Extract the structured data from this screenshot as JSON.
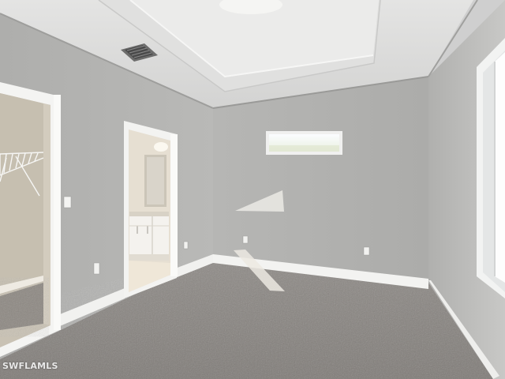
{
  "scene": {
    "description_tag": "empty-bedroom-photo",
    "colors": {
      "wall_left": "#b7b7b5",
      "wall_back": "#b2b2b0",
      "wall_right": "#bcbcbc",
      "ceiling": "#d9d9d8",
      "carpet": "#8a8682",
      "trim": "#f2f2f0",
      "closet_wall": "#c9c2b4",
      "bath_wall": "#e6dfd2"
    }
  },
  "watermark": {
    "text": "SWFLAMLS"
  }
}
